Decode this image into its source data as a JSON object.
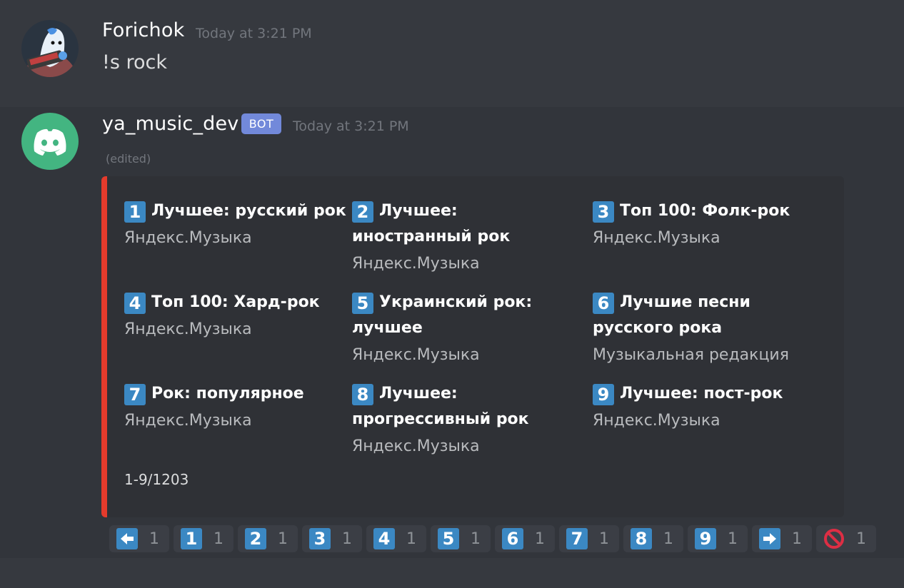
{
  "message1": {
    "username": "Forichok",
    "timestamp": "Today at 3:21 PM",
    "content": "!s rock"
  },
  "message2": {
    "username": "ya_music_dev",
    "bot_tag": "BOT",
    "timestamp": "Today at 3:21 PM",
    "edited": "(edited)",
    "embed": {
      "accent_color": "#e53b2c",
      "items": [
        {
          "num": "1",
          "title": "Лучшее: русский рок",
          "sub": "Яндекс.Музыка"
        },
        {
          "num": "2",
          "title": "Лучшее: иностранный рок",
          "sub": "Яндекс.Музыка"
        },
        {
          "num": "3",
          "title": "Топ 100: Фолк-рок",
          "sub": "Яндекс.Музыка"
        },
        {
          "num": "4",
          "title": "Топ 100: Хард-рок",
          "sub": "Яндекс.Музыка"
        },
        {
          "num": "5",
          "title": "Украинский рок: лучшее",
          "sub": "Яндекс.Музыка"
        },
        {
          "num": "6",
          "title": "Лучшие песни русского рока",
          "sub": "Музыкальная редакция"
        },
        {
          "num": "7",
          "title": "Рок: популярное",
          "sub": "Яндекс.Музыка"
        },
        {
          "num": "8",
          "title": "Лучшее: прогрессивный рок",
          "sub": "Яндекс.Музыка"
        },
        {
          "num": "9",
          "title": "Лучшее: пост-рок",
          "sub": "Яндекс.Музыка"
        }
      ],
      "footer": "1-9/1203"
    },
    "reactions": [
      {
        "icon": "arrow-left-icon",
        "count": "1"
      },
      {
        "icon": "keycap-1",
        "label": "1",
        "count": "1"
      },
      {
        "icon": "keycap-2",
        "label": "2",
        "count": "1"
      },
      {
        "icon": "keycap-3",
        "label": "3",
        "count": "1"
      },
      {
        "icon": "keycap-4",
        "label": "4",
        "count": "1"
      },
      {
        "icon": "keycap-5",
        "label": "5",
        "count": "1"
      },
      {
        "icon": "keycap-6",
        "label": "6",
        "count": "1"
      },
      {
        "icon": "keycap-7",
        "label": "7",
        "count": "1"
      },
      {
        "icon": "keycap-8",
        "label": "8",
        "count": "1"
      },
      {
        "icon": "keycap-9",
        "label": "9",
        "count": "1"
      },
      {
        "icon": "arrow-right-icon",
        "count": "1"
      },
      {
        "icon": "prohibited-icon",
        "count": "1"
      }
    ]
  },
  "colors": {
    "background": "#36393f",
    "bot_tag": "#7289da",
    "keycap": "#3b88c3",
    "discord_green": "#43b581"
  }
}
